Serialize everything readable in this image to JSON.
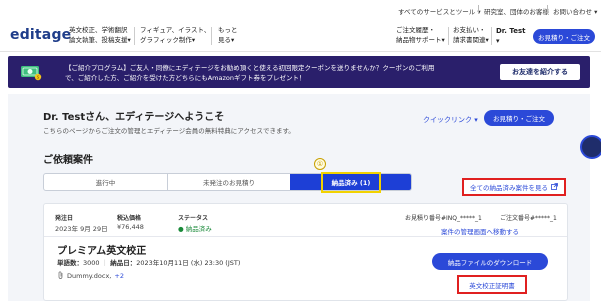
{
  "utility": {
    "services": "すべてのサービスとツール ▾",
    "org": "研究室、団体のお客様",
    "contact": "お問い合わせ ▾"
  },
  "header": {
    "logo": "editage",
    "nav": [
      {
        "line1": "英文校正、学術翻訳",
        "line2": "論文執筆、投稿支援▾"
      },
      {
        "line1": "フィギュア、イラスト、",
        "line2": "グラフィック制作▾"
      },
      {
        "line1": "もっと",
        "line2": "見る▾"
      },
      {
        "line1": "ご注文履歴・",
        "line2": "納品物サポート▾"
      },
      {
        "line1": "お支払い・",
        "line2": "請求書関連▾"
      }
    ],
    "user_line1": "Dr. Test",
    "user_line2": "▾",
    "quote_button": "お見積り・ご注文"
  },
  "promo": {
    "text": "【ご紹介プログラム】ご友人・同僚にエディテージをお勧め頂くと使える初回限定クーポンを送りませんか？クーポンのご利用で、ご紹介した方、ご紹介を受けた方どちらにもAmazonギフト券をプレゼント！",
    "button": "お友達を紹介する",
    "icon": "money-icon"
  },
  "welcome": {
    "title": "Dr. Testさん、エディテージへようこそ",
    "subtitle": "こちらのページからご注文の管理とエディテージ会員の無料特典にアクセスできます。",
    "quick_link": "クイックリンク ▾",
    "quote_button": "お見積り・ご注文"
  },
  "requests": {
    "title": "ご依頼案件",
    "tabs": [
      "進行中",
      "未発注のお見積り",
      "納品済み (1)"
    ],
    "marker": "①",
    "view_all": "全ての納品済み案件を見る"
  },
  "card": {
    "labels": {
      "date": "発注日",
      "price": "税込価格",
      "status": "ステータス"
    },
    "date": "2023年 9月 29日",
    "price": "¥76,448",
    "status": "● 納品済み",
    "order_no": "お見積り番号#INQ_*****_1",
    "order_no2": "ご注文番号#*****_1",
    "manage_link": "案件の管理画面へ移動する",
    "product": "プレミアム英文校正",
    "word_count_label": "単語数：",
    "word_count": "3000",
    "delivery_label": "納品日：",
    "delivery": "2023年10月11日 (水) 23:30 (JST)",
    "file": "Dummy.docx,",
    "file_more": "+2",
    "download_button": "納品ファイルのダウンロード",
    "certificate_button": "英文校正証明書"
  },
  "colors": {
    "accent": "#2b49d8",
    "navy": "#2a1f6b",
    "highlight_red": "#e02020",
    "highlight_yellow": "#f2d200"
  }
}
